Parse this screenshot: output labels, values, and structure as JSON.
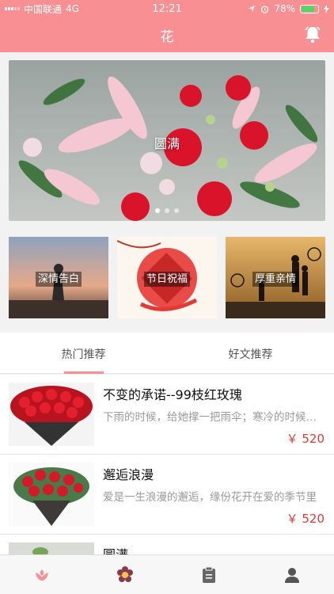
{
  "status_bar": {
    "carrier": "中国联通",
    "network": "4G",
    "time": "12:21",
    "battery_percent": "78%",
    "battery_level": 0.78
  },
  "navbar": {
    "title": "花",
    "bell_icon": "bell-icon"
  },
  "banner": {
    "caption": "圆满",
    "slides": 3,
    "active_index": 0
  },
  "categories": [
    {
      "label": "深情告白"
    },
    {
      "label": "节日祝福"
    },
    {
      "label": "厚重亲情"
    }
  ],
  "tabs": [
    {
      "label": "热门推荐",
      "active": true
    },
    {
      "label": "好文推荐",
      "active": false
    }
  ],
  "items": [
    {
      "name": "不变的承诺--99枝红玫瑰",
      "desc": "下雨的时候，给她撑一把雨伞；寒冷的时候，给她一个温暖的怀抱",
      "price": "￥ 520"
    },
    {
      "name": "邂逅浪漫",
      "desc": "爱是一生浪漫的邂逅，缘份花开在爱的季节里",
      "price": "￥ 520"
    },
    {
      "name": "圆满",
      "desc": "",
      "price": ""
    }
  ],
  "tabbar": [
    {
      "icon": "flower-home-icon"
    },
    {
      "icon": "flower-icon"
    },
    {
      "icon": "clipboard-icon"
    },
    {
      "icon": "user-icon"
    }
  ],
  "colors": {
    "accent": "#f88f93",
    "price": "#e53935"
  }
}
